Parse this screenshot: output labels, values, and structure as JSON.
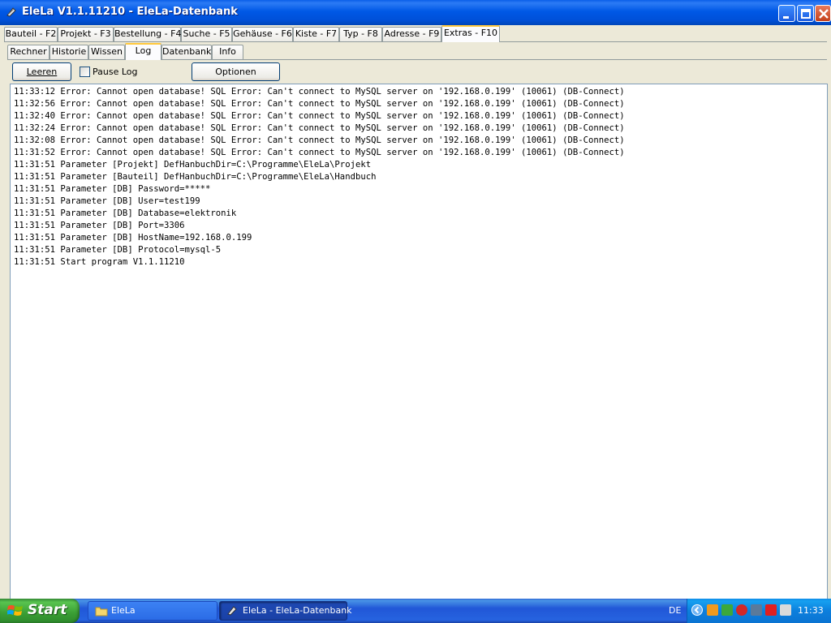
{
  "window": {
    "title": "EleLa V1.1.11210  - EleLa-Datenbank"
  },
  "main_tabs": [
    {
      "label": "Bauteil - F2",
      "active": false
    },
    {
      "label": "Projekt - F3",
      "active": false
    },
    {
      "label": "Bestellung - F4",
      "active": false
    },
    {
      "label": "Suche - F5",
      "active": false
    },
    {
      "label": "Gehäuse - F6",
      "active": false
    },
    {
      "label": "Kiste - F7",
      "active": false
    },
    {
      "label": "Typ - F8",
      "active": false
    },
    {
      "label": "Adresse - F9",
      "active": false
    },
    {
      "label": "Extras - F10",
      "active": true
    }
  ],
  "sub_tabs": [
    {
      "label": "Rechner",
      "active": false
    },
    {
      "label": "Historie",
      "active": false
    },
    {
      "label": "Wissen",
      "active": false
    },
    {
      "label": "Log",
      "active": true
    },
    {
      "label": "Datenbank",
      "active": false
    },
    {
      "label": "Info",
      "active": false
    }
  ],
  "toolbar": {
    "clear_label": "Leeren",
    "pause_label": "Pause Log",
    "pause_checked": false,
    "options_label": "Optionen"
  },
  "log": [
    "11:33:12 Error: Cannot open database! SQL Error: Can't connect to MySQL server on '192.168.0.199' (10061) (DB-Connect)",
    "11:32:56 Error: Cannot open database! SQL Error: Can't connect to MySQL server on '192.168.0.199' (10061) (DB-Connect)",
    "11:32:40 Error: Cannot open database! SQL Error: Can't connect to MySQL server on '192.168.0.199' (10061) (DB-Connect)",
    "11:32:24 Error: Cannot open database! SQL Error: Can't connect to MySQL server on '192.168.0.199' (10061) (DB-Connect)",
    "11:32:08 Error: Cannot open database! SQL Error: Can't connect to MySQL server on '192.168.0.199' (10061) (DB-Connect)",
    "11:31:52 Error: Cannot open database! SQL Error: Can't connect to MySQL server on '192.168.0.199' (10061) (DB-Connect)",
    "11:31:51 Parameter [Projekt] DefHanbuchDir=C:\\Programme\\EleLa\\Projekt",
    "11:31:51 Parameter [Bauteil] DefHanbuchDir=C:\\Programme\\EleLa\\Handbuch",
    "11:31:51 Parameter [DB] Password=*****",
    "11:31:51 Parameter [DB] User=test199",
    "11:31:51 Parameter [DB] Database=elektronik",
    "11:31:51 Parameter [DB] Port=3306",
    "11:31:51 Parameter [DB] HostName=192.168.0.199",
    "11:31:51 Parameter [DB] Protocol=mysql-5",
    "11:31:51 Start program V1.1.11210"
  ],
  "taskbar": {
    "start_label": "Start",
    "tasks": [
      {
        "label": "EleLa",
        "icon": "folder-icon"
      },
      {
        "label": "EleLa - EleLa-Datenbank",
        "icon": "elela-app-icon"
      }
    ],
    "language": "DE",
    "clock": "11:33"
  }
}
